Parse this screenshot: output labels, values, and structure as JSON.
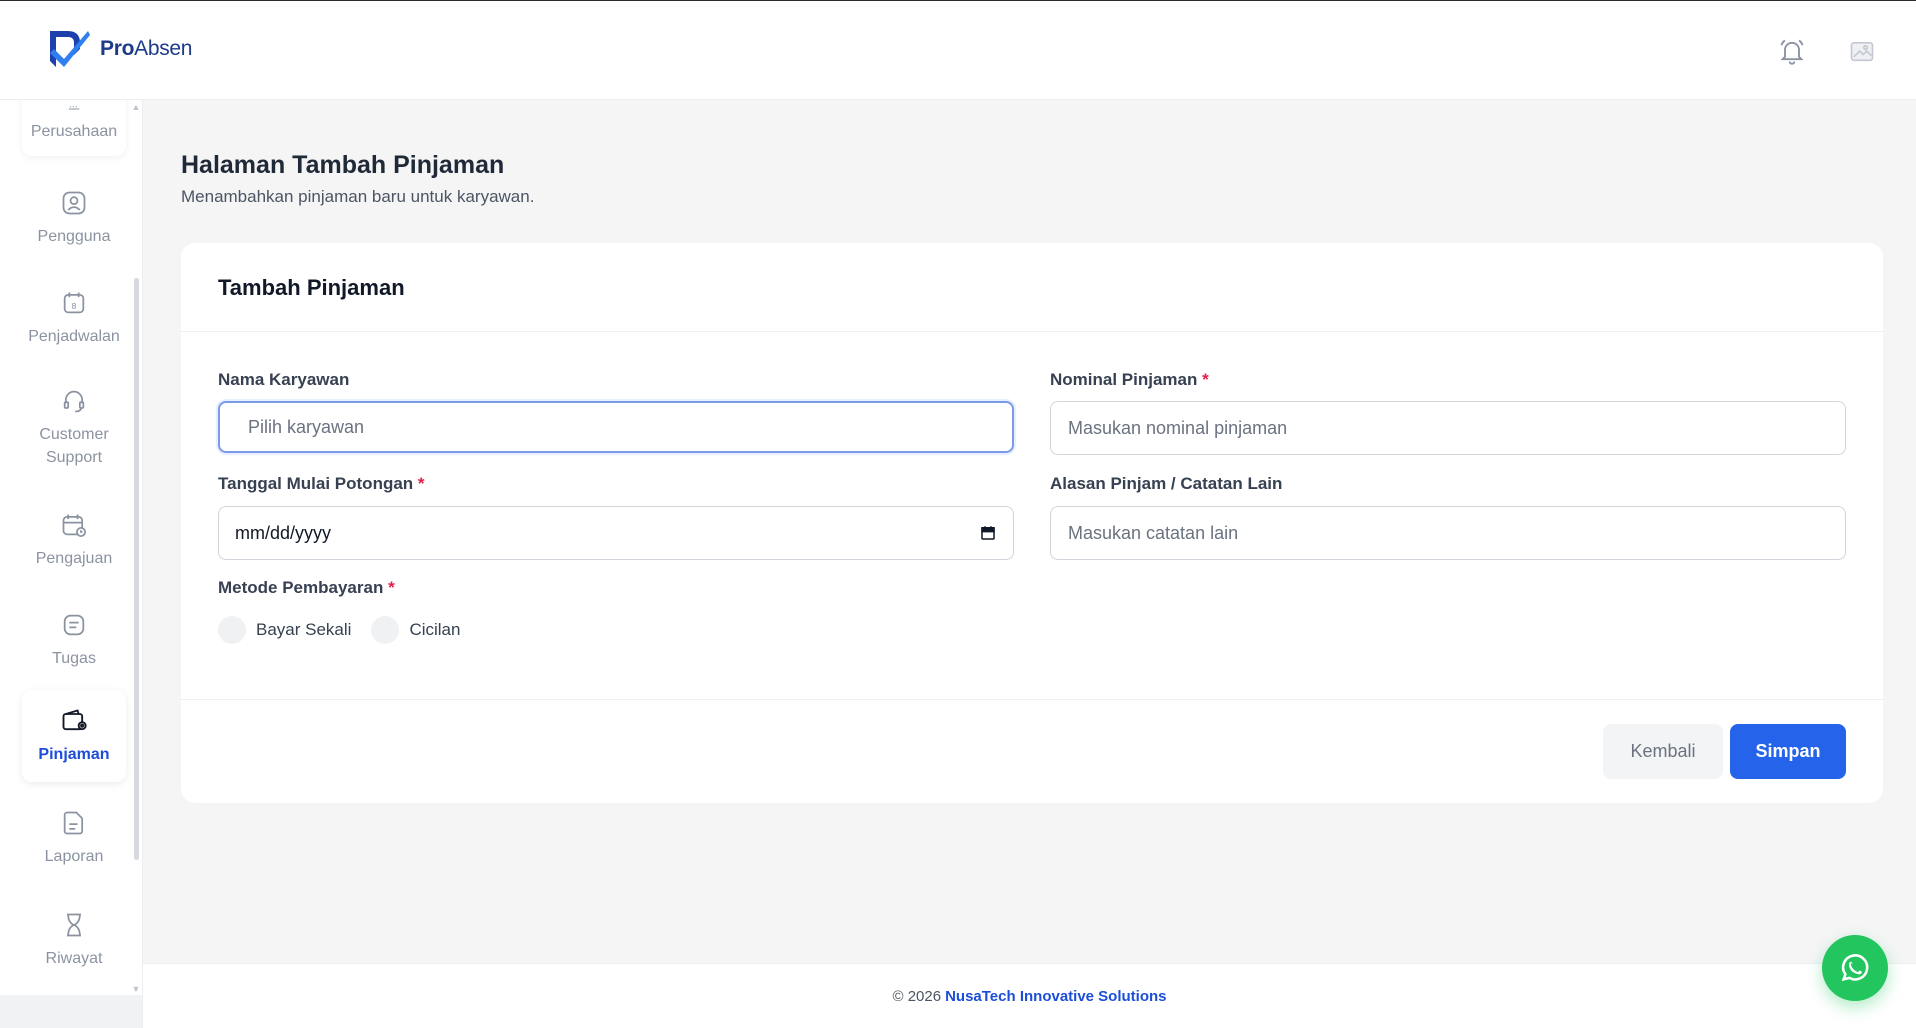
{
  "app": {
    "brand_bold": "Pro",
    "brand_light": "Absen"
  },
  "sidebar": {
    "items": [
      {
        "label": "Perusahaan",
        "icon": "building-icon"
      },
      {
        "label": "Pengguna",
        "icon": "user-icon"
      },
      {
        "label": "Penjadwalan",
        "icon": "calendar-icon"
      },
      {
        "label": "Customer Support",
        "icon": "headset-icon"
      },
      {
        "label": "Pengajuan",
        "icon": "calendar-clock-icon"
      },
      {
        "label": "Tugas",
        "icon": "task-icon"
      },
      {
        "label": "Pinjaman",
        "icon": "wallet-icon",
        "active": true
      },
      {
        "label": "Laporan",
        "icon": "document-icon"
      },
      {
        "label": "Riwayat",
        "icon": "hourglass-icon"
      }
    ]
  },
  "page": {
    "title": "Halaman Tambah Pinjaman",
    "subtitle": "Menambahkan pinjaman baru untuk karyawan."
  },
  "form": {
    "card_title": "Tambah Pinjaman",
    "employee": {
      "label": "Nama Karyawan",
      "placeholder": "Pilih karyawan"
    },
    "amount": {
      "label": "Nominal Pinjaman",
      "required": "*",
      "placeholder": "Masukan nominal pinjaman"
    },
    "start_date": {
      "label": "Tanggal Mulai Potongan",
      "required": "*",
      "value": "mm/dd/yyyy"
    },
    "reason": {
      "label": "Alasan Pinjam / Catatan Lain",
      "placeholder": "Masukan catatan lain"
    },
    "payment_method": {
      "label": "Metode Pembayaran",
      "required": "*",
      "options": [
        "Bayar Sekali",
        "Cicilan"
      ]
    },
    "back_label": "Kembali",
    "save_label": "Simpan"
  },
  "footer": {
    "copyright": "© 2026",
    "company": "NusaTech Innovative Solutions"
  },
  "colors": {
    "primary": "#2563eb",
    "brand": "#1e3a8a",
    "whatsapp": "#22c55e",
    "required": "#e11d48"
  }
}
